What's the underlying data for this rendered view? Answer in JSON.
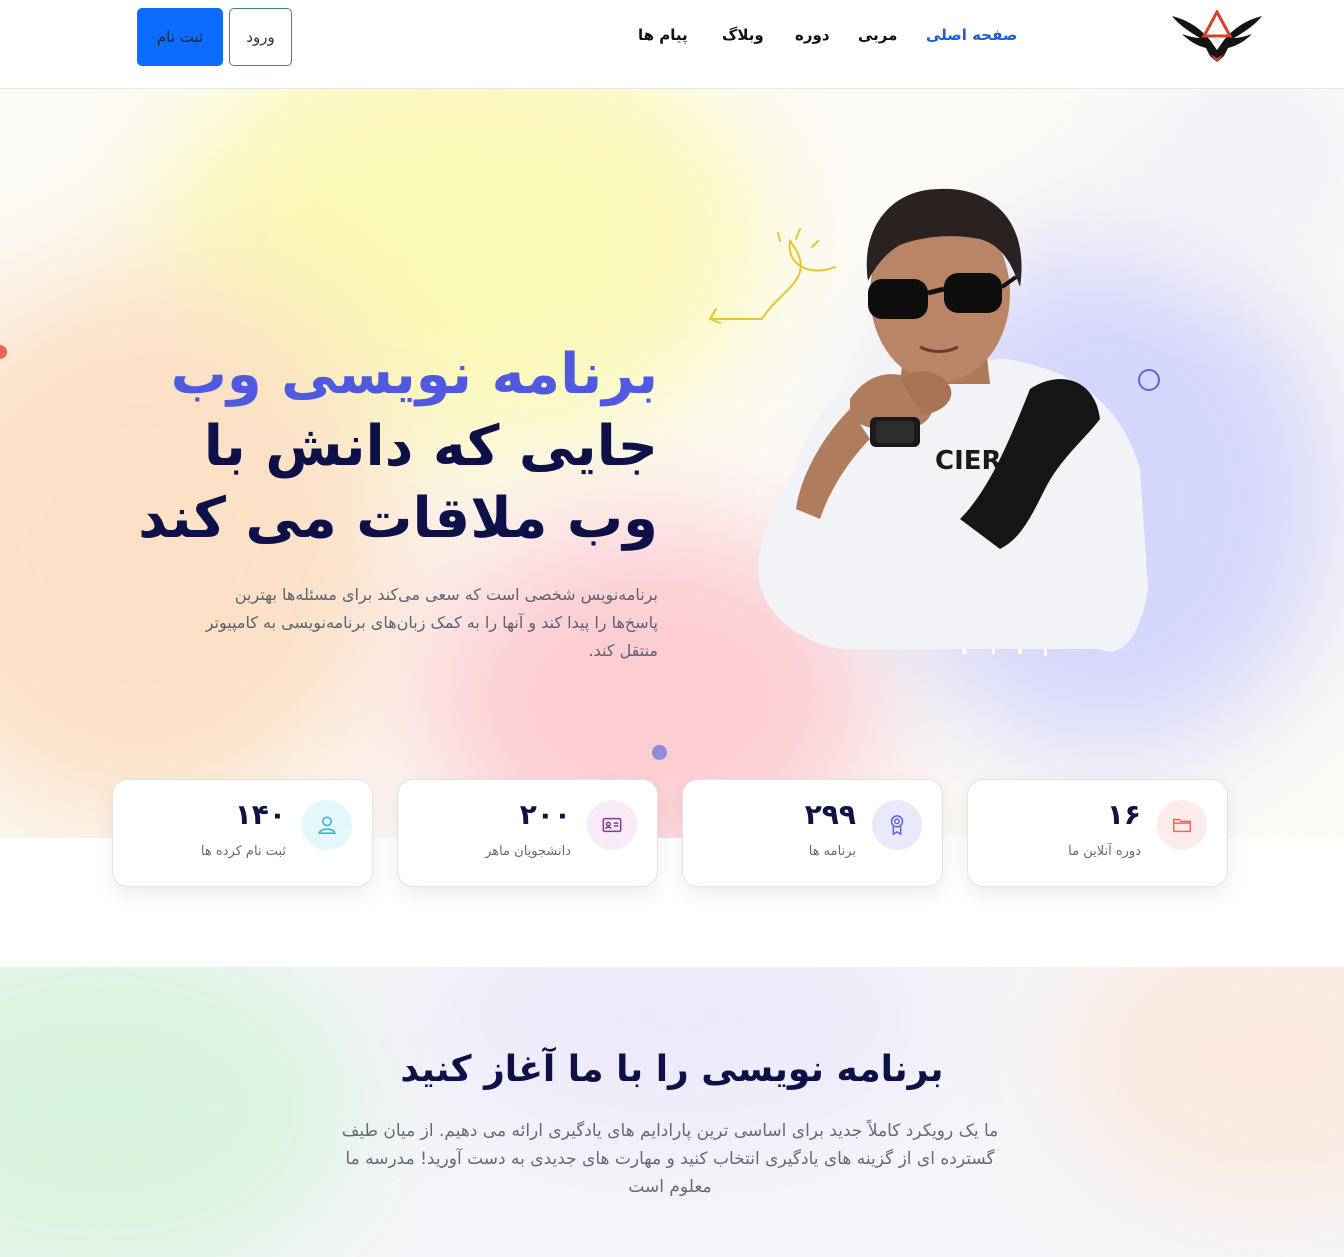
{
  "header": {
    "nav": [
      {
        "label": "صفحه اصلی",
        "active": true
      },
      {
        "label": "مربی",
        "active": false
      },
      {
        "label": "دوره",
        "active": false
      },
      {
        "label": "وبلاگ",
        "active": false
      },
      {
        "label": "پیام ها",
        "active": false
      }
    ],
    "login_label": "ورود",
    "signup_label": "ثبت نام"
  },
  "hero": {
    "title_line1": "برنامه نویسی وب",
    "title_line2": "جایی که دانش با",
    "title_line3": "وب ملاقات می کند",
    "subtitle": "برنامه‌نویس شخصی است که سعی می‌کند برای مسئله‌ها بهترین پاسخ‌ها را پیدا کند و آنها را به کمک زبان‌های برنامه‌نویسی به کامپیوتر منتقل کند."
  },
  "stats": [
    {
      "number": "۱۶",
      "label": "دوره آنلاین ما",
      "icon": "folder-icon",
      "color": "#f0655b",
      "bg": "#fdeceb"
    },
    {
      "number": "۲۹۹",
      "label": "برنامه ها",
      "icon": "award-icon",
      "color": "#5d62d6",
      "bg": "#e9e9fb"
    },
    {
      "number": "۲۰۰",
      "label": "دانشجویان ماهر",
      "icon": "id-card-icon",
      "color": "#8a3a8c",
      "bg": "#f8eaf6"
    },
    {
      "number": "۱۴۰",
      "label": "ثبت نام کرده ها",
      "icon": "user-icon",
      "color": "#2bb4c8",
      "bg": "#e4f7fa"
    }
  ],
  "section2": {
    "title": "برنامه نویسی را با ما آغاز کنید",
    "text": "ما یک رویکرد کاملاً جدید برای اساسی ترین پارادایم های یادگیری ارائه می دهیم. از میان طیف گسترده ای از گزینه های یادگیری انتخاب کنید و مهارت های جدیدی به دست آورید! مدرسه ما معلوم است"
  },
  "colors": {
    "accent": "#4f5ae0",
    "dark_text": "#0d1148",
    "signup_button": "#0b6cff",
    "nav_active": "#1a5fd6"
  }
}
